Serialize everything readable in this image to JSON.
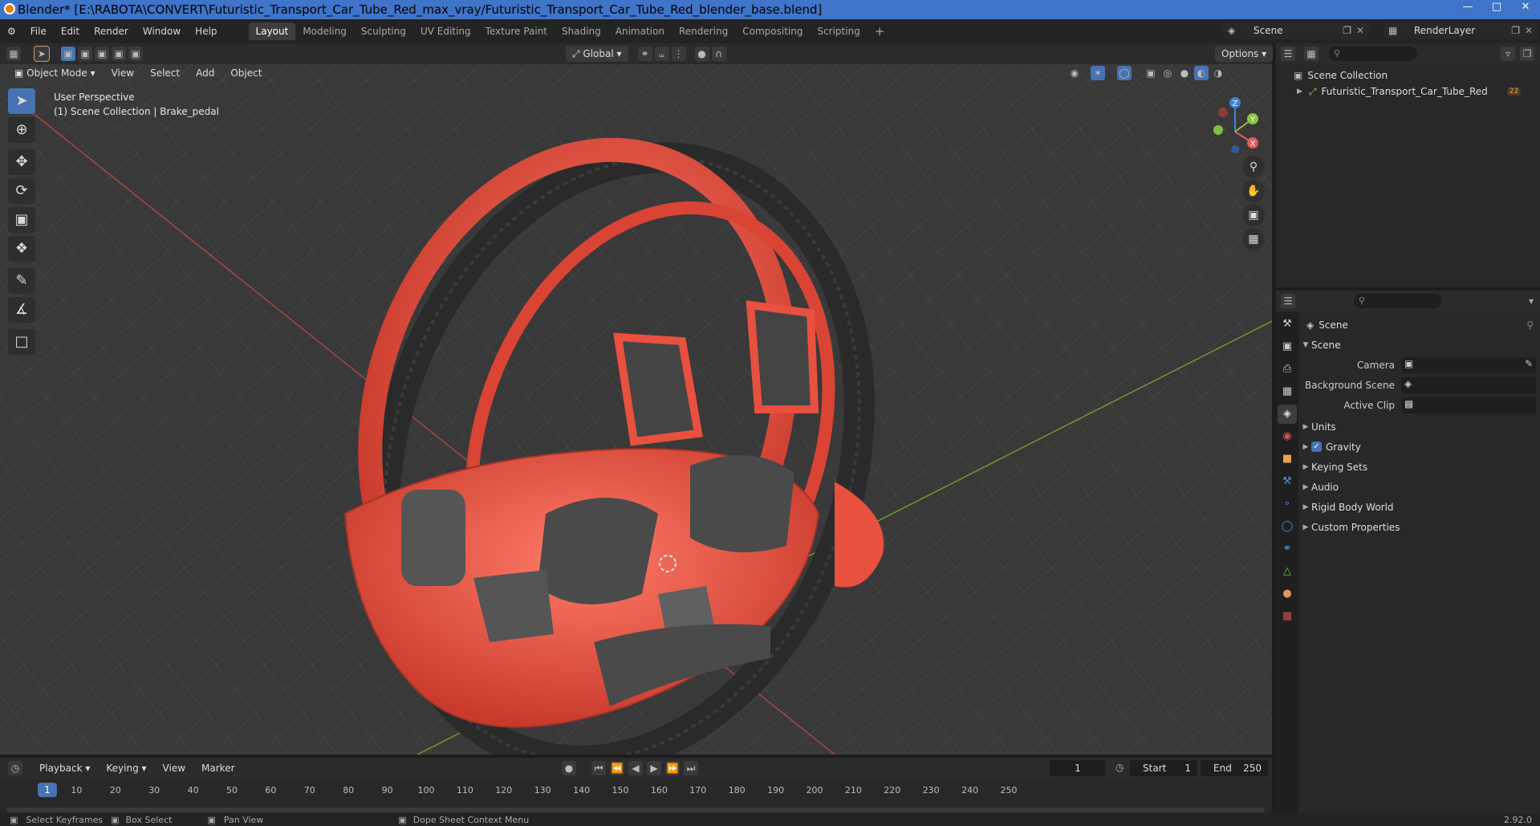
{
  "window": {
    "title": "Blender* [E:\\RABOTA\\CONVERT\\Futuristic_Transport_Car_Tube_Red_max_vray/Futuristic_Transport_Car_Tube_Red_blender_base.blend]"
  },
  "menu": [
    "File",
    "Edit",
    "Render",
    "Window",
    "Help"
  ],
  "workspaces": [
    "Layout",
    "Modeling",
    "Sculpting",
    "UV Editing",
    "Texture Paint",
    "Shading",
    "Animation",
    "Rendering",
    "Compositing",
    "Scripting"
  ],
  "active_workspace": "Layout",
  "scene_selector": "Scene",
  "render_layer": "RenderLayer",
  "viewport": {
    "mode": "Object Mode",
    "menus": [
      "View",
      "Select",
      "Add",
      "Object"
    ],
    "orientation": "Global",
    "options": "Options",
    "perspective": "User Perspective",
    "collection_info": "(1) Scene Collection | Brake_pedal",
    "axes": {
      "x": "X",
      "y": "Y",
      "z": "Z"
    }
  },
  "outliner": {
    "root": "Scene Collection",
    "items": [
      {
        "name": "Futuristic_Transport_Car_Tube_Red",
        "badge": "22"
      }
    ]
  },
  "properties": {
    "context": "Scene",
    "panel_title": "Scene",
    "fields": [
      {
        "label": "Camera",
        "value": ""
      },
      {
        "label": "Background Scene",
        "value": ""
      },
      {
        "label": "Active Clip",
        "value": ""
      }
    ],
    "sections": [
      {
        "label": "Units",
        "checkbox": false
      },
      {
        "label": "Gravity",
        "checkbox": true
      },
      {
        "label": "Keying Sets",
        "checkbox": false
      },
      {
        "label": "Audio",
        "checkbox": false
      },
      {
        "label": "Rigid Body World",
        "checkbox": false
      },
      {
        "label": "Custom Properties",
        "checkbox": false
      }
    ]
  },
  "timeline": {
    "menus": [
      "Playback",
      "Keying",
      "View",
      "Marker"
    ],
    "current_frame": "1",
    "start_label": "Start",
    "start": "1",
    "end_label": "End",
    "end": "250",
    "ruler": [
      "10",
      "20",
      "30",
      "40",
      "50",
      "60",
      "70",
      "80",
      "90",
      "100",
      "110",
      "120",
      "130",
      "140",
      "150",
      "160",
      "170",
      "180",
      "190",
      "200",
      "210",
      "220",
      "230",
      "240",
      "250"
    ],
    "ruler_current": "1"
  },
  "status_bar": {
    "items": [
      "Select Keyframes",
      "Box Select",
      "Pan View",
      "Dope Sheet Context Menu"
    ],
    "version": "2.92.0"
  },
  "colors": {
    "accent": "#4772b3",
    "titlebar": "#3f74c8",
    "car_red": "#e8503f",
    "axis_x": "#e05a5a",
    "axis_y": "#8cc63f",
    "axis_z": "#3e82d8"
  }
}
